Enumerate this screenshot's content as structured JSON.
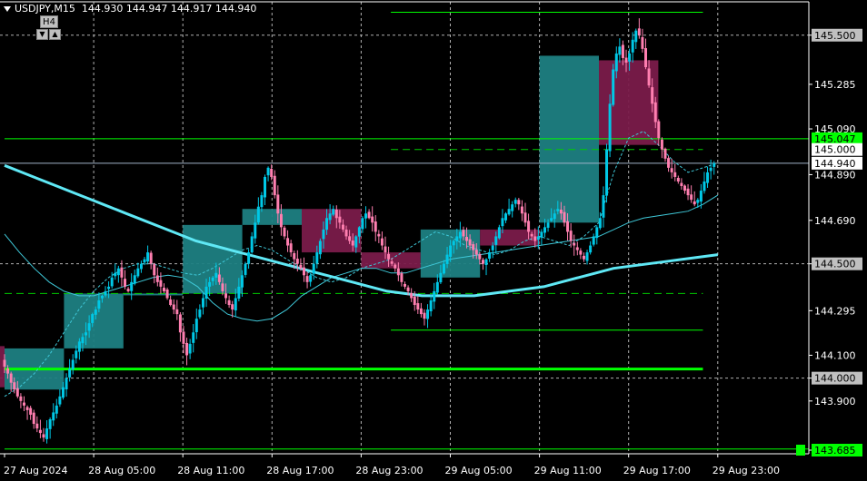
{
  "header": {
    "symbol": "USDJPY,M15",
    "open": "144.930",
    "high": "144.947",
    "low": "144.917",
    "close": "144.940"
  },
  "timeframe_widget": {
    "label": "H4",
    "down": "▼",
    "up": "▲"
  },
  "colors": {
    "background": "#000000",
    "bull": "#00C8E6",
    "bear": "#FF7FB0",
    "h4_bull": "#1E7F82",
    "h4_bear": "#7A1B4A",
    "ma_thick": "#5FE8F5",
    "ma_thin": "#3FC8D8",
    "level_green": "#00FF00",
    "dashed_green": "#00CC00",
    "grid": "#B0B0B0",
    "axis": "#FFFFFF",
    "price_line": "#9FB3C8"
  },
  "chart_data": {
    "type": "candlestick",
    "title": "USDJPY,M15",
    "ylim": [
      143.685,
      145.63
    ],
    "y_ticks": [
      "145.500",
      "145.285",
      "145.090",
      "144.890",
      "144.690",
      "144.500",
      "144.295",
      "144.100",
      "144.000",
      "143.900",
      "143.685"
    ],
    "x_ticks": [
      "27 Aug 2024",
      "28 Aug 05:00",
      "28 Aug 11:00",
      "28 Aug 17:00",
      "28 Aug 23:00",
      "29 Aug 05:00",
      "29 Aug 11:00",
      "29 Aug 17:00",
      "29 Aug 23:00"
    ],
    "price_labels": [
      {
        "text": "145.500",
        "value": 145.5,
        "style": "gray"
      },
      {
        "text": "145.047",
        "value": 145.047,
        "style": "green"
      },
      {
        "text": "145.000",
        "value": 145.0,
        "style": "white"
      },
      {
        "text": "144.940",
        "value": 144.94,
        "style": "white"
      },
      {
        "text": "144.500",
        "value": 144.5,
        "style": "gray"
      },
      {
        "text": "144.000",
        "value": 144.0,
        "style": "gray"
      },
      {
        "text": "143.685",
        "value": 143.685,
        "style": "green"
      }
    ],
    "current_price": 144.94,
    "horizontal_levels": [
      {
        "value": 145.6,
        "from_hour": 26,
        "to_hour": 47,
        "style": "solid-green"
      },
      {
        "value": 145.047,
        "from_hour": 0,
        "to_hour": 60,
        "style": "solid-green"
      },
      {
        "value": 145.0,
        "from_hour": 26,
        "to_hour": 47,
        "style": "dashed-green"
      },
      {
        "value": 144.37,
        "from_hour": 0,
        "to_hour": 47,
        "style": "dashed-green"
      },
      {
        "value": 144.21,
        "from_hour": 26,
        "to_hour": 47,
        "style": "solid-green"
      },
      {
        "value": 144.04,
        "from_hour": 0,
        "to_hour": 47,
        "style": "thick-green"
      },
      {
        "value": 143.69,
        "from_hour": 0,
        "to_hour": 60,
        "style": "solid-green"
      }
    ],
    "h4_candles": [
      {
        "start": -1,
        "end": 0,
        "open": 144.14,
        "close": 143.96
      },
      {
        "start": 0,
        "end": 4,
        "open": 143.95,
        "close": 144.13
      },
      {
        "start": 4,
        "end": 8,
        "open": 144.13,
        "close": 144.37
      },
      {
        "start": 8,
        "end": 12,
        "open": 144.37,
        "close": 144.37
      },
      {
        "start": 12,
        "end": 16,
        "open": 144.37,
        "close": 144.67
      },
      {
        "start": 16,
        "end": 20,
        "open": 144.67,
        "close": 144.74
      },
      {
        "start": 20,
        "end": 24,
        "open": 144.74,
        "close": 144.55
      },
      {
        "start": 24,
        "end": 28,
        "open": 144.55,
        "close": 144.48
      },
      {
        "start": 28,
        "end": 32,
        "open": 144.44,
        "close": 144.65
      },
      {
        "start": 32,
        "end": 36,
        "open": 144.65,
        "close": 144.58
      },
      {
        "start": 36,
        "end": 40,
        "open": 144.68,
        "close": 145.41
      },
      {
        "start": 40,
        "end": 44,
        "open": 145.39,
        "close": 145.02
      }
    ],
    "m15_close": [
      144.05,
      144.02,
      143.98,
      143.95,
      143.92,
      143.9,
      143.88,
      143.86,
      143.84,
      143.8,
      143.78,
      143.76,
      143.74,
      143.78,
      143.82,
      143.85,
      143.88,
      143.92,
      143.96,
      144.0,
      144.04,
      144.08,
      144.12,
      144.16,
      144.18,
      144.2,
      144.24,
      144.28,
      144.3,
      144.34,
      144.36,
      144.38,
      144.4,
      144.44,
      144.46,
      144.48,
      144.44,
      144.4,
      144.38,
      144.42,
      144.45,
      144.48,
      144.5,
      144.52,
      144.55,
      144.5,
      144.45,
      144.42,
      144.4,
      144.38,
      144.35,
      144.32,
      144.3,
      144.28,
      144.2,
      144.15,
      144.1,
      144.15,
      144.2,
      144.26,
      144.3,
      144.35,
      144.4,
      144.42,
      144.44,
      144.46,
      144.42,
      144.38,
      144.35,
      144.32,
      144.3,
      144.35,
      144.4,
      144.45,
      144.5,
      144.55,
      144.62,
      144.68,
      144.75,
      144.8,
      144.88,
      144.92,
      144.88,
      144.8,
      144.72,
      144.66,
      144.62,
      144.58,
      144.55,
      144.52,
      144.5,
      144.48,
      144.45,
      144.42,
      144.45,
      144.5,
      144.55,
      144.6,
      144.65,
      144.7,
      144.72,
      144.74,
      144.7,
      144.68,
      144.65,
      144.62,
      144.6,
      144.58,
      144.62,
      144.66,
      144.7,
      144.72,
      144.7,
      144.68,
      144.64,
      144.62,
      144.58,
      144.55,
      144.52,
      144.5,
      144.48,
      144.45,
      144.42,
      144.4,
      144.38,
      144.35,
      144.32,
      144.3,
      144.28,
      144.26,
      144.3,
      144.34,
      144.38,
      144.42,
      144.46,
      144.5,
      144.54,
      144.58,
      144.6,
      144.62,
      144.64,
      144.62,
      144.6,
      144.58,
      144.56,
      144.54,
      144.52,
      144.5,
      144.52,
      144.55,
      144.58,
      144.62,
      144.66,
      144.7,
      144.72,
      144.74,
      144.76,
      144.78,
      144.76,
      144.72,
      144.68,
      144.64,
      144.62,
      144.6,
      144.62,
      144.64,
      144.66,
      144.68,
      144.7,
      144.72,
      144.74,
      144.72,
      144.68,
      144.64,
      144.6,
      144.58,
      144.56,
      144.54,
      144.52,
      144.55,
      144.58,
      144.62,
      144.66,
      144.7,
      144.8,
      145.0,
      145.2,
      145.35,
      145.42,
      145.45,
      145.4,
      145.38,
      145.42,
      145.48,
      145.52,
      145.5,
      145.44,
      145.36,
      145.28,
      145.2,
      145.12,
      145.05,
      145.0,
      144.96,
      144.92,
      144.9,
      144.88,
      144.86,
      144.84,
      144.82,
      144.8,
      144.78,
      144.76,
      144.78,
      144.82,
      144.86,
      144.9,
      144.92,
      144.94
    ],
    "ma_fast": [
      143.92,
      143.96,
      144.02,
      144.1,
      144.2,
      144.3,
      144.38,
      144.44,
      144.48,
      144.5,
      144.5,
      144.48,
      144.46,
      144.45,
      144.48,
      144.52,
      144.56,
      144.58,
      144.56,
      144.52,
      144.48,
      144.44,
      144.42,
      144.44,
      144.48,
      144.5,
      144.52,
      144.56,
      144.6,
      144.64,
      144.62,
      144.58,
      144.56,
      144.54,
      144.56,
      144.6,
      144.62,
      144.6,
      144.58,
      144.62,
      144.68,
      144.9,
      145.05,
      145.08,
      145.02,
      144.95,
      144.9,
      144.92,
      144.94
    ],
    "ma_mid": [
      144.63,
      144.55,
      144.48,
      144.42,
      144.38,
      144.36,
      144.36,
      144.38,
      144.4,
      144.42,
      144.44,
      144.45,
      144.44,
      144.4,
      144.33,
      144.28,
      144.26,
      144.25,
      144.26,
      144.3,
      144.36,
      144.4,
      144.44,
      144.46,
      144.48,
      144.48,
      144.46,
      144.46,
      144.48,
      144.5,
      144.52,
      144.53,
      144.54,
      144.55,
      144.56,
      144.57,
      144.58,
      144.59,
      144.6,
      144.61,
      144.62,
      144.65,
      144.68,
      144.7,
      144.71,
      144.72,
      144.73,
      144.76,
      144.8
    ],
    "ma_slow": [
      144.93,
      144.9,
      144.87,
      144.84,
      144.81,
      144.78,
      144.75,
      144.72,
      144.69,
      144.66,
      144.63,
      144.6,
      144.58,
      144.56,
      144.54,
      144.52,
      144.5,
      144.48,
      144.46,
      144.44,
      144.42,
      144.4,
      144.38,
      144.37,
      144.36,
      144.36,
      144.36,
      144.36,
      144.37,
      144.38,
      144.39,
      144.4,
      144.42,
      144.44,
      144.46,
      144.48,
      144.49,
      144.5,
      144.51,
      144.52,
      144.53,
      144.54
    ]
  }
}
